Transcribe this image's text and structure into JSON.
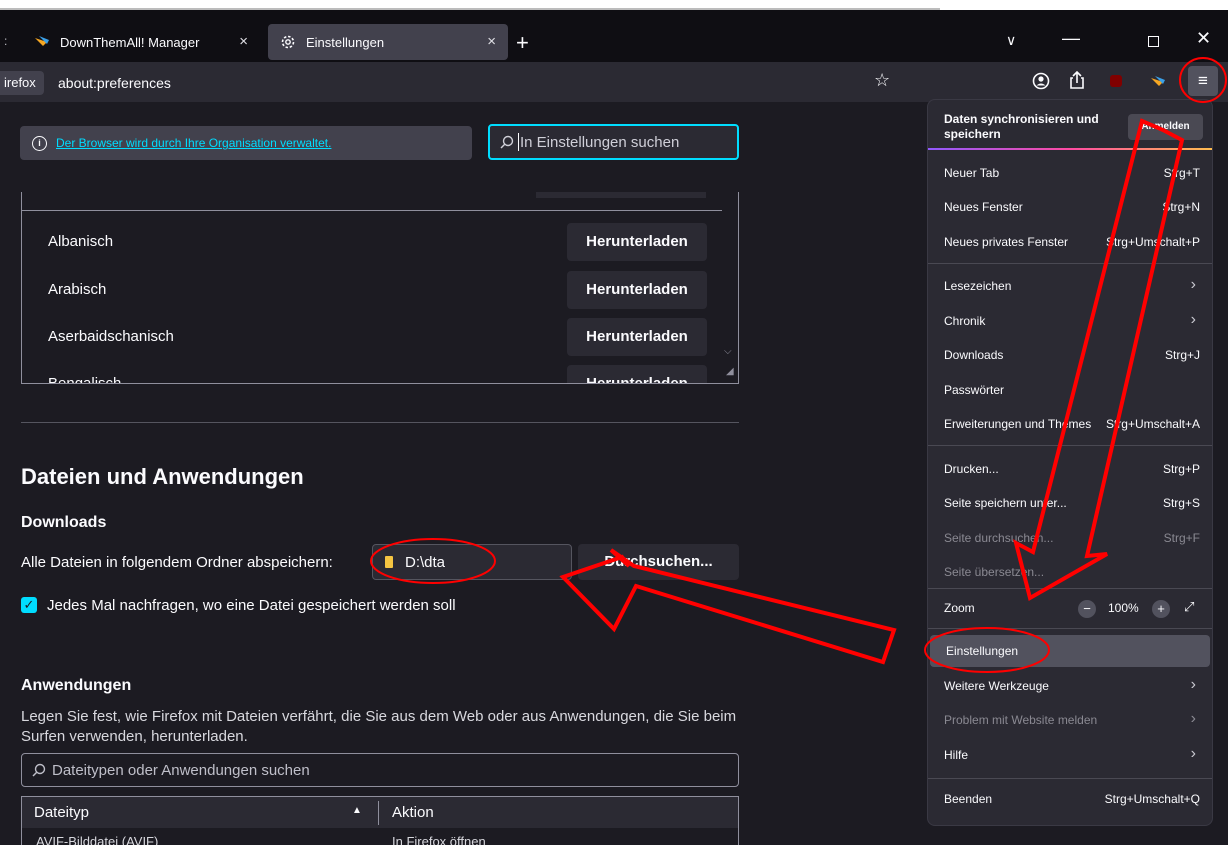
{
  "tabs": [
    {
      "title": "DownThemAll! Manager",
      "close": "×"
    },
    {
      "title": "Einstellungen",
      "close": "×"
    }
  ],
  "tabbar": {
    "edge_glyph": ":",
    "new_tab": "+",
    "list_tabs": "∨",
    "minimize": "—",
    "close": "✕"
  },
  "navbar": {
    "identity": "irefox",
    "url": "about:preferences",
    "star": "☆",
    "menu": "≡"
  },
  "prefs": {
    "org_notice": "Der Browser wird durch Ihre Organisation verwaltet.",
    "search_placeholder": "In Einstellungen suchen",
    "languages": [
      {
        "name": "Albanisch",
        "button": "Herunterladen"
      },
      {
        "name": "Arabisch",
        "button": "Herunterladen"
      },
      {
        "name": "Aserbaidschanisch",
        "button": "Herunterladen"
      },
      {
        "name": "Bengalisch",
        "button": "Herunterladen"
      }
    ],
    "section_title": "Dateien und Anwendungen",
    "downloads_title": "Downloads",
    "save_label": "Alle Dateien in folgendem Ordner abspeichern:",
    "folder_value": "D:\\dta",
    "browse_button": "Durchsuchen...",
    "ask_label": "Jedes Mal nachfragen, wo eine Datei gespeichert werden soll",
    "ask_checked": true,
    "apps_title": "Anwendungen",
    "apps_desc": "Legen Sie fest, wie Firefox mit Dateien verfährt, die Sie aus dem Web oder aus Anwendungen, die Sie beim Surfen verwenden, herunterladen.",
    "apps_search_placeholder": "Dateitypen oder Anwendungen suchen",
    "table": {
      "col_type": "Dateityp",
      "col_action": "Aktion",
      "sort_indicator": "▲"
    },
    "table_partial_row": {
      "type": "AVIF-Bilddatei (AVIF)",
      "action": "In Firefox öffnen"
    }
  },
  "app_menu": {
    "sync_title": "Daten synchronisieren und speichern",
    "sync_button": "Anmelden",
    "items": [
      {
        "label": "Neuer Tab",
        "shortcut": "Strg+T"
      },
      {
        "label": "Neues Fenster",
        "shortcut": "Strg+N"
      },
      {
        "label": "Neues privates Fenster",
        "shortcut": "Strg+Umschalt+P"
      },
      {
        "label": "Lesezeichen",
        "arrow": "›"
      },
      {
        "label": "Chronik",
        "arrow": "›"
      },
      {
        "label": "Downloads",
        "shortcut": "Strg+J"
      },
      {
        "label": "Passwörter"
      },
      {
        "label": "Erweiterungen und Themes",
        "shortcut": "Strg+Umschalt+A"
      },
      {
        "label": "Drucken...",
        "shortcut": "Strg+P"
      },
      {
        "label": "Seite speichern unter...",
        "shortcut": "Strg+S"
      },
      {
        "label": "Seite durchsuchen...",
        "shortcut": "Strg+F",
        "disabled": true
      },
      {
        "label": "Seite übersetzen...",
        "disabled": true
      },
      {
        "label": "Zoom"
      },
      {
        "label": "Einstellungen"
      },
      {
        "label": "Weitere Werkzeuge",
        "arrow": "›"
      },
      {
        "label": "Problem mit Website melden",
        "arrow": "›",
        "disabled": true
      },
      {
        "label": "Hilfe",
        "arrow": "›"
      },
      {
        "label": "Beenden",
        "shortcut": "Strg+Umschalt+Q"
      }
    ],
    "zoom": {
      "minus": "−",
      "value": "100%",
      "plus": "+",
      "fullscreen": "⤢"
    }
  },
  "colors": {
    "accent": "#00ddff",
    "annotation": "#ff0000",
    "menu_bg": "#2b2a33",
    "page_bg": "#1c1b22"
  }
}
